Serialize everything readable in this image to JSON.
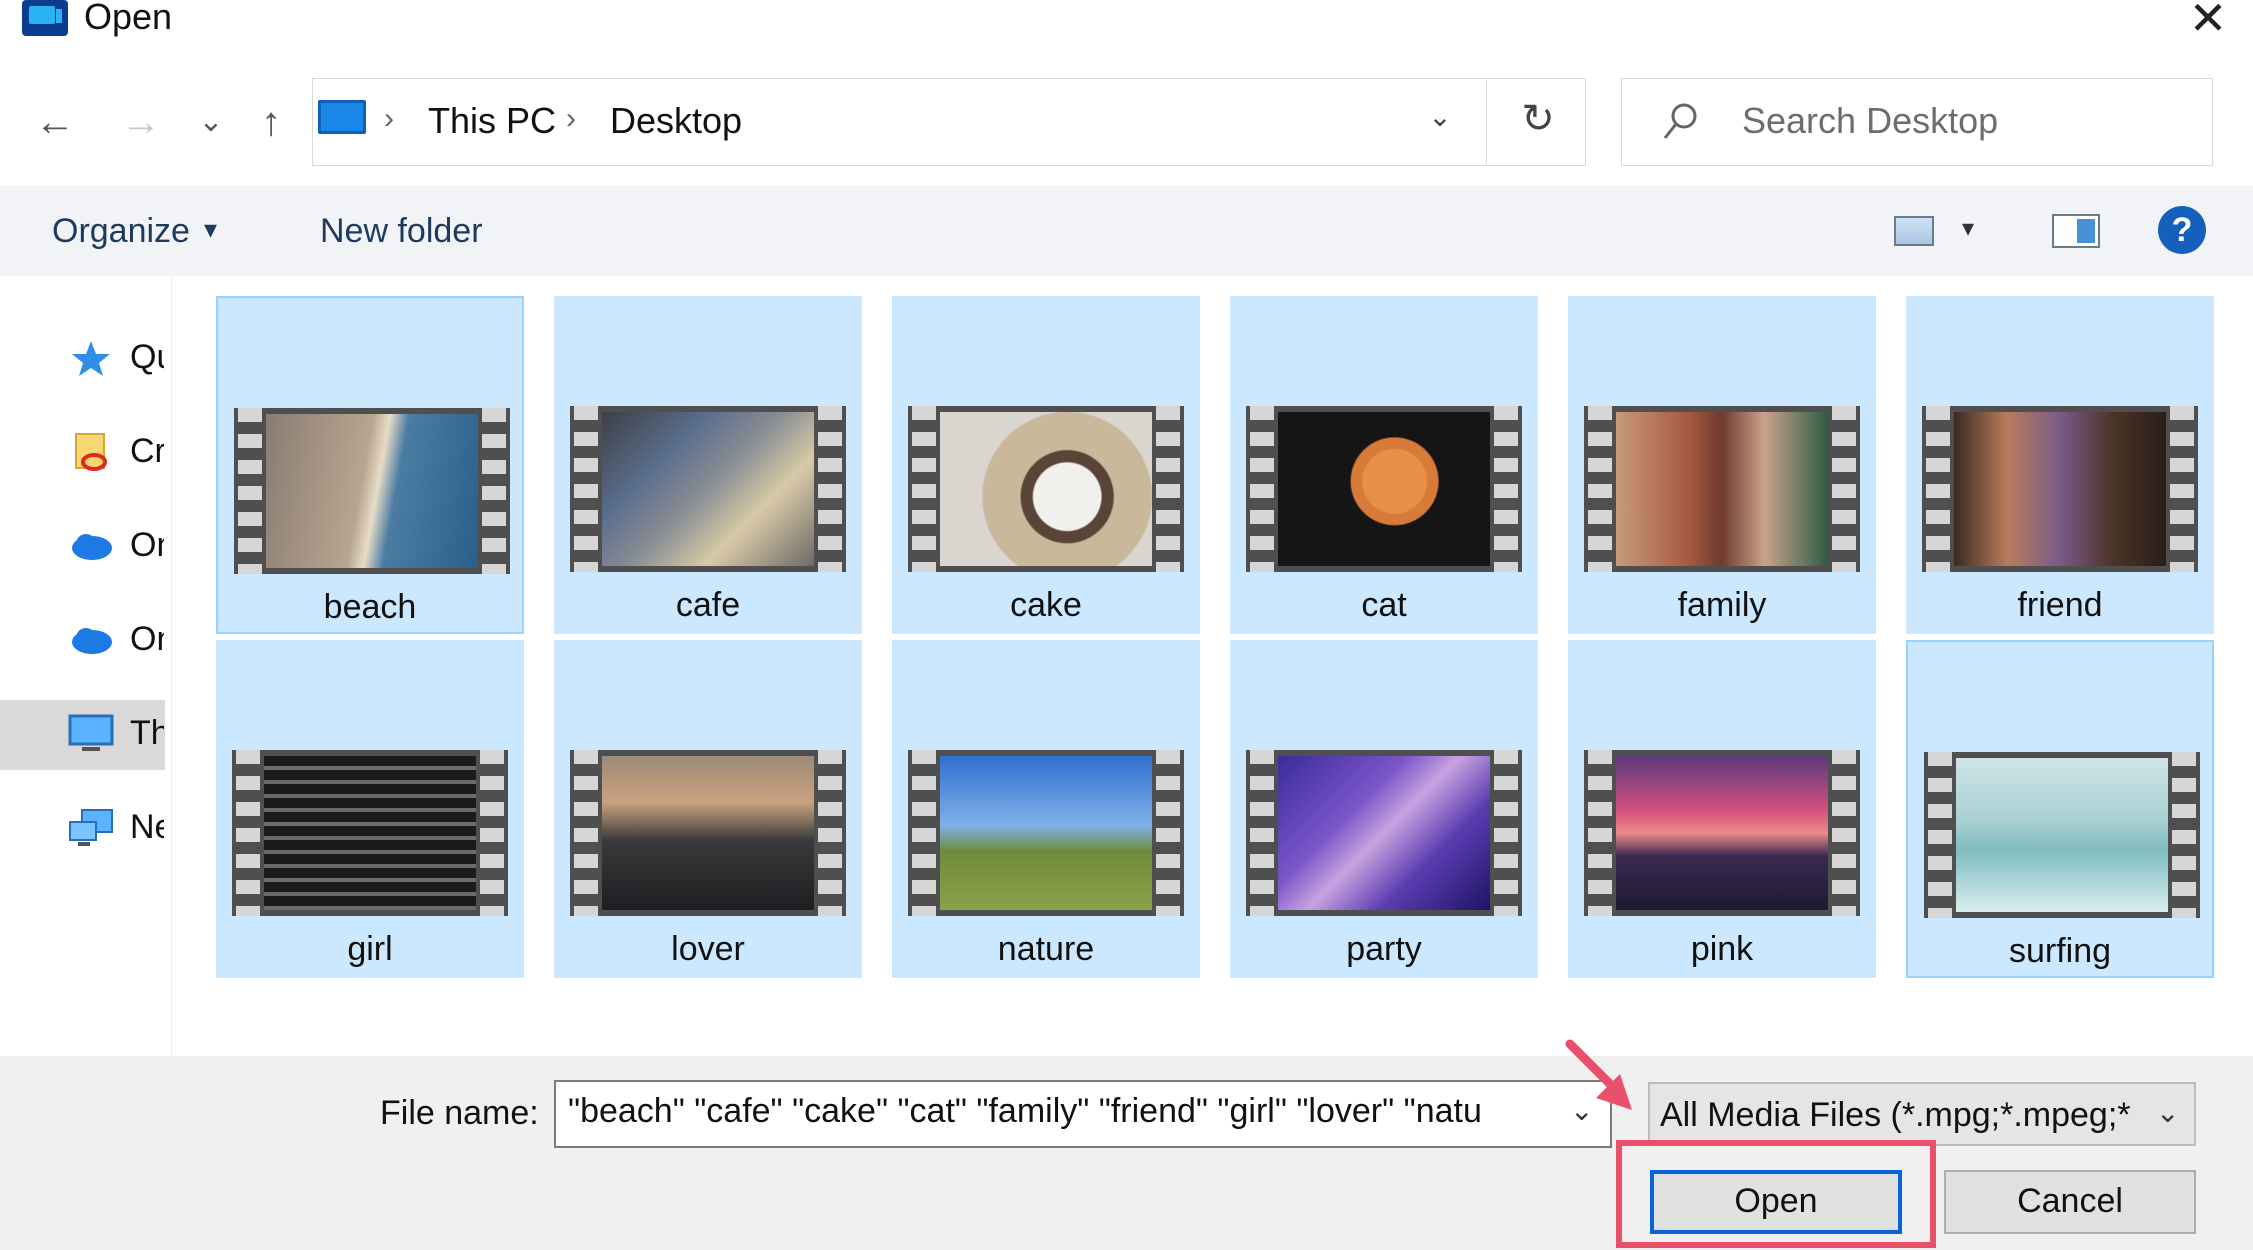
{
  "window": {
    "title": "Open",
    "close_glyph": "✕"
  },
  "nav": {
    "back": "←",
    "forward": "→",
    "recent": "⌄",
    "up": "↑"
  },
  "address": {
    "crumbs": [
      "This PC",
      "Desktop"
    ],
    "separator": "›",
    "dropdown": "⌄",
    "refresh": "↻"
  },
  "search": {
    "placeholder": "Search Desktop"
  },
  "toolbar": {
    "organize": "Organize",
    "organize_caret": "▾",
    "new_folder": "New folder",
    "view_caret": "▾",
    "help": "?"
  },
  "nav_pane": [
    {
      "label": "Quick access",
      "icon": "star-icon"
    },
    {
      "label": "Creative Cloud Files",
      "icon": "creative-cloud-icon"
    },
    {
      "label": "OneDrive",
      "icon": "onedrive-icon"
    },
    {
      "label": "OneDrive",
      "icon": "onedrive-icon"
    },
    {
      "label": "This PC",
      "icon": "pc-icon",
      "selected": true
    },
    {
      "label": "Network",
      "icon": "network-icon"
    }
  ],
  "files": [
    {
      "name": "beach"
    },
    {
      "name": "cafe"
    },
    {
      "name": "cake"
    },
    {
      "name": "cat"
    },
    {
      "name": "family"
    },
    {
      "name": "friend"
    },
    {
      "name": "girl"
    },
    {
      "name": "lover"
    },
    {
      "name": "nature"
    },
    {
      "name": "party"
    },
    {
      "name": "pink"
    },
    {
      "name": "surfing"
    }
  ],
  "footer": {
    "file_name_label": "File name:",
    "file_name_value": "\"beach\" \"cafe\" \"cake\" \"cat\" \"family\" \"friend\" \"girl\" \"lover\" \"natu",
    "dropdown": "⌄",
    "filter": "All Media Files (*.mpg;*.mpeg;*",
    "open": "Open",
    "cancel": "Cancel"
  },
  "colors": {
    "selection": "#cce8ff",
    "accent": "#0b62d6",
    "callout": "#e8506b"
  }
}
